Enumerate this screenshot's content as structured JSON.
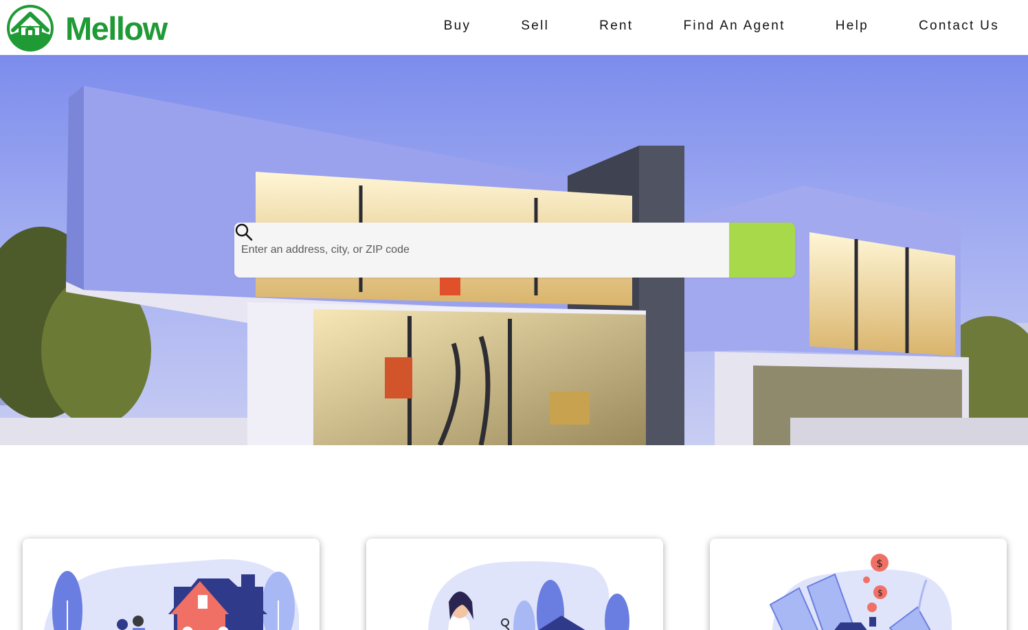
{
  "brand": {
    "name": "Mellow",
    "color": "#1f9a35"
  },
  "nav": {
    "items": [
      {
        "label": "Buy"
      },
      {
        "label": "Sell"
      },
      {
        "label": "Rent"
      },
      {
        "label": "Find An Agent"
      },
      {
        "label": "Help"
      },
      {
        "label": "Contact Us"
      }
    ]
  },
  "search": {
    "placeholder": "Enter an address, city, or ZIP code",
    "button_color": "#a8d94a",
    "icon": "search-icon"
  },
  "cards": [
    {
      "illustration": "family-house-illustration"
    },
    {
      "illustration": "agent-keys-illustration"
    },
    {
      "illustration": "money-house-illustration"
    }
  ]
}
